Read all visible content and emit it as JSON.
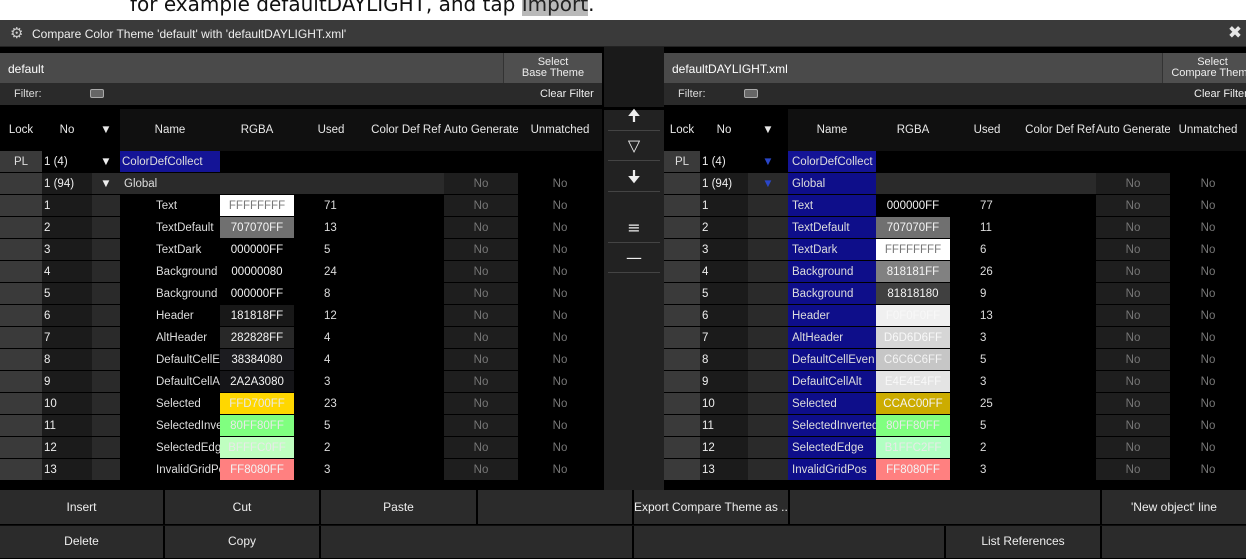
{
  "caption": {
    "before": "for example defaultDAYLIGHT, and tap ",
    "highlight": "Import",
    "after": "."
  },
  "window": {
    "title": "Compare Color Theme 'default' with 'defaultDAYLIGHT.xml'",
    "gear_icon": "gear-icon",
    "close_icon": "close-icon"
  },
  "left": {
    "title": "default",
    "select_btn": [
      "Select",
      "Base Theme"
    ],
    "filter_label": "Filter:",
    "clear_filter": "Clear Filter",
    "headers": [
      "Lock",
      "No",
      "▼",
      "Name",
      "RGBA",
      "Used",
      "Color Def Ref",
      "Auto Generate",
      "Unmatched"
    ],
    "rows": [
      {
        "lock": "PL",
        "no": "1 (4)",
        "tri": "▼",
        "name": "ColorDefCollect",
        "rgba": "",
        "rgba_bg": "",
        "used": "",
        "auto": "",
        "unm": "",
        "kind": "coll"
      },
      {
        "lock": "",
        "no": "1 (94)",
        "tri": "▼",
        "name": "Global",
        "rgba": "",
        "rgba_bg": "",
        "used": "",
        "auto": "No",
        "unm": "No",
        "kind": "group"
      },
      {
        "lock": "",
        "no": "1",
        "name": "Text",
        "rgba": "FFFFFFFF",
        "rgba_bg": "#ffffff",
        "used": "71",
        "auto": "No",
        "unm": "No"
      },
      {
        "lock": "",
        "no": "2",
        "name": "TextDefault",
        "rgba": "707070FF",
        "rgba_bg": "#707070",
        "used": "13",
        "auto": "No",
        "unm": "No"
      },
      {
        "lock": "",
        "no": "3",
        "name": "TextDark",
        "rgba": "000000FF",
        "rgba_bg": "#000000",
        "used": "5",
        "auto": "No",
        "unm": "No"
      },
      {
        "lock": "",
        "no": "4",
        "name": "Background",
        "rgba": "00000080",
        "rgba_bg": "#000000",
        "used": "24",
        "auto": "No",
        "unm": "No"
      },
      {
        "lock": "",
        "no": "5",
        "name": "Background",
        "rgba": "000000FF",
        "rgba_bg": "#000000",
        "used": "8",
        "auto": "No",
        "unm": "No"
      },
      {
        "lock": "",
        "no": "6",
        "name": "Header",
        "rgba": "181818FF",
        "rgba_bg": "#181818",
        "used": "12",
        "auto": "No",
        "unm": "No"
      },
      {
        "lock": "",
        "no": "7",
        "name": "AltHeader",
        "rgba": "282828FF",
        "rgba_bg": "#282828",
        "used": "4",
        "auto": "No",
        "unm": "No"
      },
      {
        "lock": "",
        "no": "8",
        "name": "DefaultCellEven",
        "rgba": "38384080",
        "rgba_bg": "#1c1c20",
        "used": "4",
        "auto": "No",
        "unm": "No"
      },
      {
        "lock": "",
        "no": "9",
        "name": "DefaultCellAlt",
        "rgba": "2A2A3080",
        "rgba_bg": "#151518",
        "used": "3",
        "auto": "No",
        "unm": "No"
      },
      {
        "lock": "",
        "no": "10",
        "name": "Selected",
        "rgba": "FFD700FF",
        "rgba_bg": "#ffd700",
        "used": "23",
        "auto": "No",
        "unm": "No"
      },
      {
        "lock": "",
        "no": "11",
        "name": "SelectedInverted",
        "rgba": "80FF80FF",
        "rgba_bg": "#80ff80",
        "used": "5",
        "auto": "No",
        "unm": "No"
      },
      {
        "lock": "",
        "no": "12",
        "name": "SelectedEdge",
        "rgba": "BFFFC0FF",
        "rgba_bg": "#bfffc0",
        "used": "2",
        "auto": "No",
        "unm": "No"
      },
      {
        "lock": "",
        "no": "13",
        "name": "InvalidGridPos",
        "rgba": "FF8080FF",
        "rgba_bg": "#ff8080",
        "used": "3",
        "auto": "No",
        "unm": "No"
      }
    ]
  },
  "right": {
    "title": "defaultDAYLIGHT.xml",
    "select_btn": [
      "Select",
      "Compare Theme"
    ],
    "filter_label": "Filter:",
    "clear_filter": "Clear Filter",
    "headers": [
      "Lock",
      "No",
      "▼",
      "Name",
      "RGBA",
      "Used",
      "Color Def Ref",
      "Auto Generate",
      "Unmatched"
    ],
    "rows": [
      {
        "lock": "PL",
        "no": "1 (4)",
        "tri": "▼",
        "name": "ColorDefCollect",
        "rgba": "",
        "rgba_bg": "",
        "used": "",
        "auto": "",
        "unm": "",
        "kind": "coll"
      },
      {
        "lock": "",
        "no": "1 (94)",
        "tri": "▼",
        "name": "Global",
        "rgba": "",
        "rgba_bg": "",
        "used": "",
        "auto": "No",
        "unm": "No",
        "kind": "group"
      },
      {
        "lock": "",
        "no": "1",
        "name": "Text",
        "rgba": "000000FF",
        "rgba_bg": "#000000",
        "used": "77",
        "auto": "No",
        "unm": "No"
      },
      {
        "lock": "",
        "no": "2",
        "name": "TextDefault",
        "rgba": "707070FF",
        "rgba_bg": "#707070",
        "used": "11",
        "auto": "No",
        "unm": "No"
      },
      {
        "lock": "",
        "no": "3",
        "name": "TextDark",
        "rgba": "FFFFFFFF",
        "rgba_bg": "#ffffff",
        "used": "6",
        "auto": "No",
        "unm": "No"
      },
      {
        "lock": "",
        "no": "4",
        "name": "Background",
        "rgba": "818181FF",
        "rgba_bg": "#818181",
        "used": "26",
        "auto": "No",
        "unm": "No"
      },
      {
        "lock": "",
        "no": "5",
        "name": "Background",
        "rgba": "81818180",
        "rgba_bg": "#404040",
        "used": "9",
        "auto": "No",
        "unm": "No"
      },
      {
        "lock": "",
        "no": "6",
        "name": "Header",
        "rgba": "F0F0F0FF",
        "rgba_bg": "#f0f0f0",
        "used": "13",
        "auto": "No",
        "unm": "No"
      },
      {
        "lock": "",
        "no": "7",
        "name": "AltHeader",
        "rgba": "D6D6D6FF",
        "rgba_bg": "#d6d6d6",
        "used": "3",
        "auto": "No",
        "unm": "No"
      },
      {
        "lock": "",
        "no": "8",
        "name": "DefaultCellEven",
        "rgba": "C6C6C6FF",
        "rgba_bg": "#c6c6c6",
        "used": "5",
        "auto": "No",
        "unm": "No"
      },
      {
        "lock": "",
        "no": "9",
        "name": "DefaultCellAlt",
        "rgba": "E4E4E4FF",
        "rgba_bg": "#e4e4e4",
        "used": "3",
        "auto": "No",
        "unm": "No"
      },
      {
        "lock": "",
        "no": "10",
        "name": "Selected",
        "rgba": "CCAC00FF",
        "rgba_bg": "#ccac00",
        "used": "25",
        "auto": "No",
        "unm": "No"
      },
      {
        "lock": "",
        "no": "11",
        "name": "SelectedInverted",
        "rgba": "80FF80FF",
        "rgba_bg": "#80ff80",
        "used": "5",
        "auto": "No",
        "unm": "No"
      },
      {
        "lock": "",
        "no": "12",
        "name": "SelectedEdge",
        "rgba": "B1FFC2FF",
        "rgba_bg": "#b1ffc2",
        "used": "2",
        "auto": "No",
        "unm": "No"
      },
      {
        "lock": "",
        "no": "13",
        "name": "InvalidGridPos",
        "rgba": "FF8080FF",
        "rgba_bg": "#ff8080",
        "used": "3",
        "auto": "No",
        "unm": "No"
      }
    ]
  },
  "middle": {
    "icons": [
      "arrow-up-icon",
      "filter-icon",
      "arrow-down-icon",
      "menu-icon",
      "minus-icon"
    ],
    "glyphs": [
      "🠉",
      "▽",
      "🠋",
      "≡",
      "—"
    ]
  },
  "bottom": {
    "insert": "Insert",
    "cut": "Cut",
    "paste": "Paste",
    "export": "Export Compare Theme as ...",
    "new_object": "'New object' line",
    "delete": "Delete",
    "copy": "Copy",
    "list_refs": "List References"
  }
}
